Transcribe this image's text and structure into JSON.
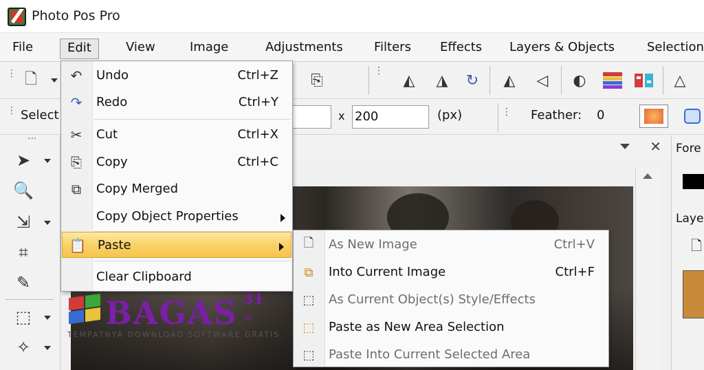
{
  "window": {
    "title": "Photo Pos Pro"
  },
  "menubar": {
    "items": [
      "File",
      "Edit",
      "View",
      "Image",
      "Adjustments",
      "Filters",
      "Effects",
      "Layers & Objects",
      "Selection"
    ]
  },
  "optbar": {
    "select_label": "Select",
    "x_label": "x",
    "height_value": "200",
    "unit_label": "(px)",
    "feather_label": "Feather:",
    "feather_value": "0"
  },
  "right_panel": {
    "foreground_label": "Fore",
    "layers_label": "Laye"
  },
  "edit_menu": {
    "items": [
      {
        "label": "Undo",
        "shortcut": "Ctrl+Z",
        "icon": "undo-icon"
      },
      {
        "label": "Redo",
        "shortcut": "Ctrl+Y",
        "icon": "redo-icon"
      },
      {
        "label": "Cut",
        "shortcut": "Ctrl+X",
        "icon": "scissors-icon"
      },
      {
        "label": "Copy",
        "shortcut": "Ctrl+C",
        "icon": "copy-icon"
      },
      {
        "label": "Copy Merged",
        "shortcut": "",
        "icon": "copy-merged-icon"
      },
      {
        "label": "Copy Object Properties",
        "shortcut": "",
        "icon": ""
      },
      {
        "label": "Paste",
        "shortcut": "",
        "icon": "paste-icon"
      },
      {
        "label": "Clear Clipboard",
        "shortcut": "",
        "icon": ""
      }
    ]
  },
  "paste_submenu": {
    "items": [
      {
        "label": "As New Image",
        "shortcut": "Ctrl+V",
        "enabled": false
      },
      {
        "label": "Into Current Image",
        "shortcut": "Ctrl+F",
        "enabled": true
      },
      {
        "label": "As Current Object(s) Style/Effects",
        "shortcut": "",
        "enabled": false
      },
      {
        "label": "Paste as New Area Selection",
        "shortcut": "",
        "enabled": true
      },
      {
        "label": "Paste Into Current Selected Area",
        "shortcut": "",
        "enabled": false
      }
    ]
  },
  "watermark": {
    "brand": "BAGAS",
    "number": "31",
    "domain": ".id",
    "tagline": "TEMPATNYA DOWNLOAD SOFTWARE GRATIS"
  },
  "colors": {
    "highlight": "#f9d266",
    "watermark": "#7a1fa8"
  }
}
